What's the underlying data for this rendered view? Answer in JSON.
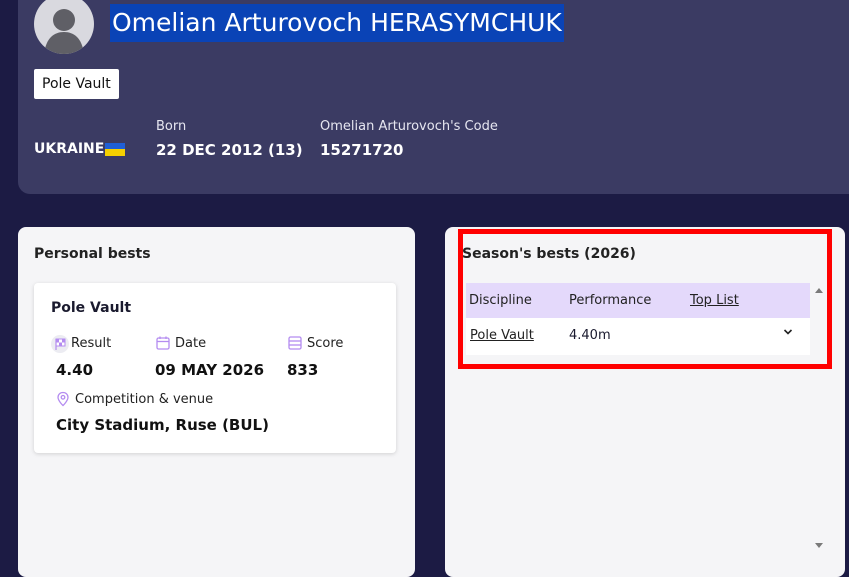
{
  "athlete": {
    "name": "Omelian Arturovoch HERASYMCHUK",
    "event": "Pole Vault",
    "country": "UKRAINE",
    "born_label": "Born",
    "born_value": "22 DEC 2012 (13)",
    "code_label": "Omelian Arturovoch's Code",
    "code_value": "15271720"
  },
  "personal_bests": {
    "title": "Personal bests",
    "card": {
      "title": "Pole Vault",
      "result_label": "Result",
      "result_value": "4.40",
      "date_label": "Date",
      "date_value": "09 MAY 2026",
      "score_label": "Score",
      "score_value": "833",
      "venue_label": "Competition & venue",
      "venue_value": "City Stadium, Ruse (BUL)"
    }
  },
  "seasons_bests": {
    "title": "Season's bests (2026)",
    "columns": [
      "Discipline",
      "Performance",
      "Top List"
    ],
    "rows": [
      {
        "discipline": "Pole Vault",
        "performance": "4.40m"
      }
    ]
  },
  "colors": {
    "background": "#1c1b44",
    "hero": "#3b3b63",
    "name_highlight": "#0a43b6",
    "table_header": "#e4d9fb",
    "accent_icon": "#b48cf0",
    "annotation_box": "#ff0000"
  },
  "icons": [
    "user-avatar-icon",
    "flag-icon",
    "calendar-icon",
    "score-icon",
    "location-pin-icon",
    "chevron-down-icon",
    "scroll-up-icon",
    "scroll-down-icon"
  ]
}
